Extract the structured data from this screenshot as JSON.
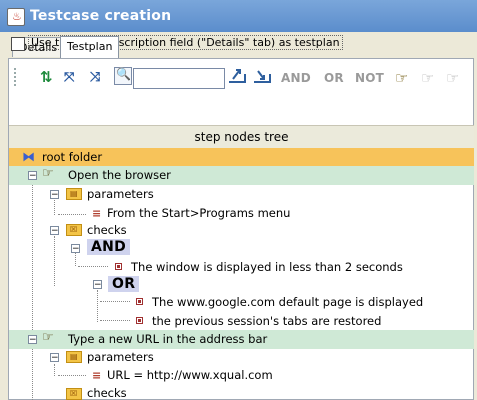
{
  "window": {
    "title": "Testcase creation"
  },
  "tabs": [
    {
      "label": "Details",
      "selected": false
    },
    {
      "label": "Testplan",
      "selected": true
    }
  ],
  "options": {
    "use_description_label": "Use testcase description field (\"Details\" tab) as testplan",
    "checked": false
  },
  "toolbar": {
    "search_value": "",
    "and_label": "AND",
    "or_label": "OR",
    "not_label": "NOT"
  },
  "tree": {
    "header": "step nodes tree",
    "root_label": "root folder",
    "step1": {
      "label": "Open the browser",
      "parameters_label": "parameters",
      "param1": "From the Start>Programs menu",
      "checks_label": "checks",
      "and_label": "AND",
      "check1": "The window is displayed in less than 2 seconds",
      "or_label": "OR",
      "check2": "The www.google.com default page is displayed",
      "check3": "the previous session's tabs are restored"
    },
    "step2": {
      "label": "Type a new URL in the address bar",
      "parameters_label": "parameters",
      "param1": "URL = http://www.xqual.com",
      "checks_label": "checks"
    }
  }
}
